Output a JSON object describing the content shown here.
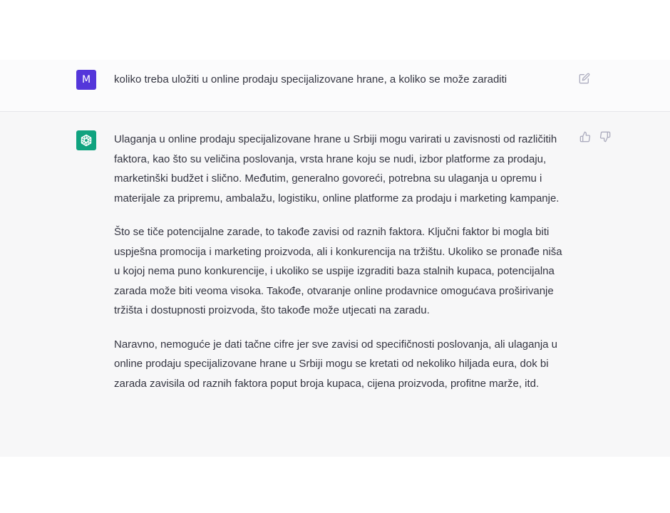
{
  "theme": {
    "user_avatar_color": "#5436da",
    "assistant_avatar_color": "#10a37f",
    "icon_color": "#acacbe"
  },
  "user_message": {
    "avatar_letter": "M",
    "text": "koliko treba uložiti u online prodaju specijalizovane hrane, a koliko se može zaraditi",
    "edit_icon": "edit-icon"
  },
  "assistant_message": {
    "avatar_icon": "openai-logo-icon",
    "paragraphs": [
      "Ulaganja u online prodaju specijalizovane hrane u Srbiji mogu varirati u zavisnosti od različitih faktora, kao što su veličina poslovanja, vrsta hrane koju se nudi, izbor platforme za prodaju, marketinški budžet i slično. Međutim, generalno govoreći, potrebna su ulaganja u opremu i materijale za pripremu, ambalažu, logistiku, online platforme za prodaju i marketing kampanje.",
      "Što se tiče potencijalne zarade, to takođe zavisi od raznih faktora. Ključni faktor bi mogla biti uspješna promocija i marketing proizvoda, ali i konkurencija na tržištu. Ukoliko se pronađe niša u kojoj nema puno konkurencije, i ukoliko se uspije izgraditi baza stalnih kupaca, potencijalna zarada može biti veoma visoka. Takođe, otvaranje online prodavnice omogućava proširivanje tržišta i dostupnosti proizvoda, što takođe može utjecati na zaradu.",
      "Naravno, nemoguće je dati tačne cifre jer sve zavisi od specifičnosti poslovanja, ali ulaganja u online prodaju specijalizovane hrane u Srbiji mogu se kretati od nekoliko hiljada eura, dok bi zarada zavisila od raznih faktora poput broja kupaca, cijena proizvoda, profitne marže, itd."
    ],
    "feedback_icons": [
      "thumbs-up-icon",
      "thumbs-down-icon"
    ]
  }
}
